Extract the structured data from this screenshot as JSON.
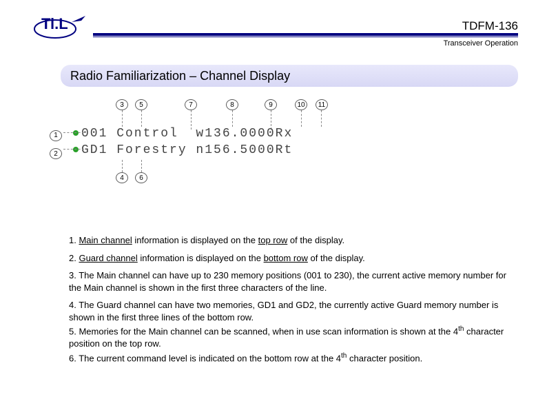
{
  "header": {
    "model": "TDFM-136",
    "subtitle": "Transceiver Operation"
  },
  "section": {
    "title": "Radio Familiarization – Channel Display"
  },
  "diagram": {
    "callouts": {
      "c1": "1",
      "c2": "2",
      "c3": "3",
      "c4": "4",
      "c5": "5",
      "c6": "6",
      "c7": "7",
      "c8": "8",
      "c9": "9",
      "c10": "10",
      "c11": "11"
    },
    "lcd": {
      "row1": "001 Control  w136.0000Rx",
      "row2": "GD1 Forestry n156.5000Rt"
    }
  },
  "bullets": {
    "b1_pre": "1. ",
    "b1_term": "Main channel",
    "b1_mid": " information is displayed on the ",
    "b1_pos": "top row",
    "b1_end": " of the display.",
    "b2_pre": "2. ",
    "b2_term": "Guard channel",
    "b2_mid": " information is displayed on the ",
    "b2_pos": "bottom row",
    "b2_end": " of the display.",
    "b3": "3. The Main channel can have up to 230 memory positions (001 to 230), the current active memory number for the Main channel is shown in the first three characters of the line.",
    "b4": "4. The Guard channel can have two memories, GD1 and GD2, the currently active Guard memory number is shown in the first three lines of the bottom row.",
    "b5_pre": "5. Memories for the Main channel can be scanned, when in use scan information is shown at the 4",
    "b5_sup": "th",
    "b5_end": " character position on the top row.",
    "b6_pre": "6. The current command level is indicated on the bottom row at the 4",
    "b6_sup": "th",
    "b6_end": " character position."
  }
}
